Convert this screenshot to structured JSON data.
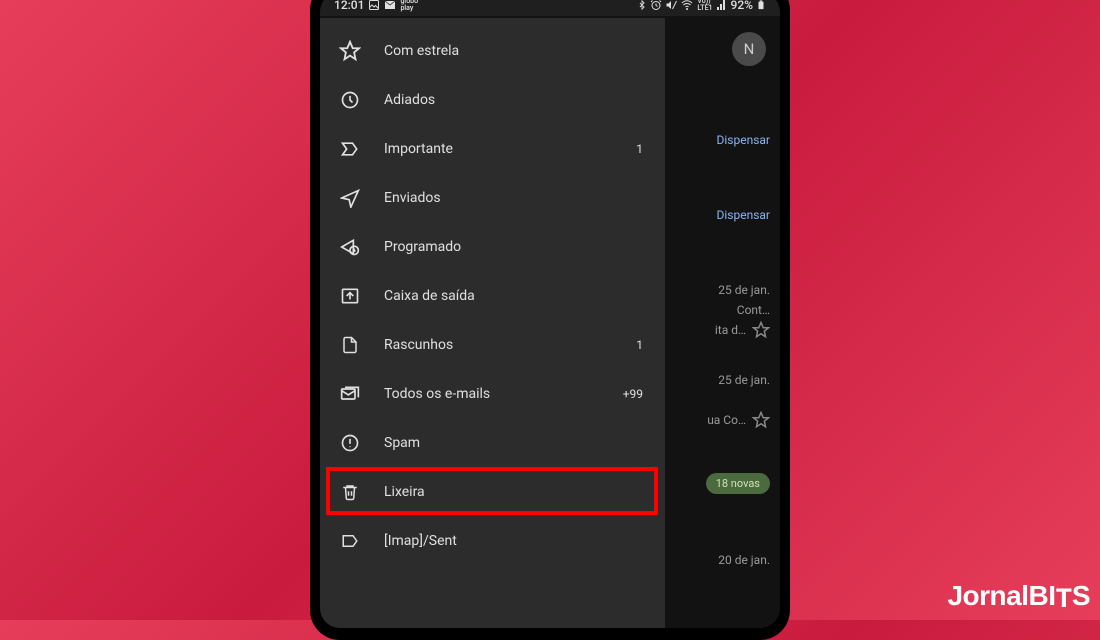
{
  "status": {
    "time": "12:01",
    "battery": "92%"
  },
  "drawer": {
    "items": [
      {
        "id": "starred",
        "label": "Com estrela",
        "count": "",
        "icon": "star"
      },
      {
        "id": "snoozed",
        "label": "Adiados",
        "count": "",
        "icon": "clock"
      },
      {
        "id": "important",
        "label": "Importante",
        "count": "1",
        "icon": "important"
      },
      {
        "id": "sent",
        "label": "Enviados",
        "count": "",
        "icon": "send"
      },
      {
        "id": "scheduled",
        "label": "Programado",
        "count": "",
        "icon": "scheduled"
      },
      {
        "id": "outbox",
        "label": "Caixa de saída",
        "count": "",
        "icon": "outbox"
      },
      {
        "id": "drafts",
        "label": "Rascunhos",
        "count": "1",
        "icon": "draft"
      },
      {
        "id": "allmail",
        "label": "Todos os e-mails",
        "count": "+99",
        "icon": "allmail"
      },
      {
        "id": "spam",
        "label": "Spam",
        "count": "",
        "icon": "spam"
      },
      {
        "id": "trash",
        "label": "Lixeira",
        "count": "",
        "icon": "trash"
      },
      {
        "id": "imapsent",
        "label": "[Imap]/Sent",
        "count": "",
        "icon": "label"
      }
    ]
  },
  "background": {
    "avatar_letter": "N",
    "dismiss1": "Dispensar",
    "dismiss2": "Dispensar",
    "date1": "25 de jan.",
    "snip1a": "Cont…",
    "snip1b": "ita d…",
    "date2": "25 de jan.",
    "snip2": "ua Co…",
    "badge": "18 novas",
    "date3": "20 de jan."
  },
  "watermark": {
    "part1": "Jornal",
    "part2": "BI",
    "part3": "T",
    "part4": "S"
  }
}
